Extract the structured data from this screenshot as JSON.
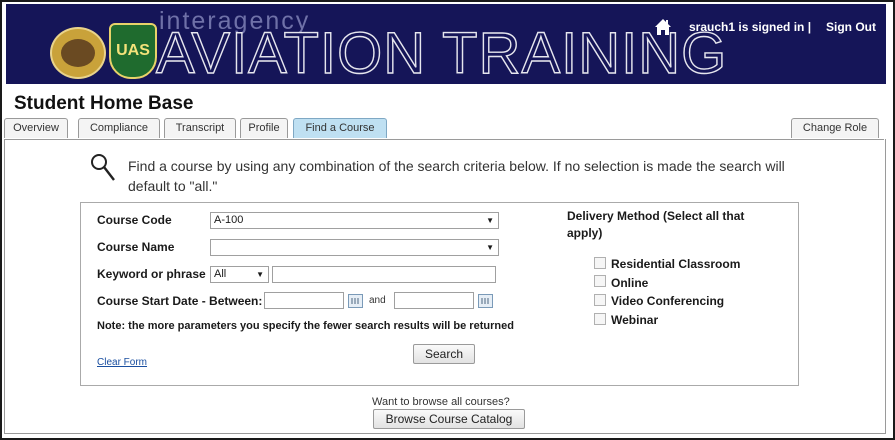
{
  "header": {
    "brand_small": "interagency",
    "brand_big": "AVIATION TRAINING",
    "shield_text": "UAS",
    "signed_in_text": "srauch1 is signed in  |",
    "sign_out": "Sign Out"
  },
  "page_title": "Student Home Base",
  "tabs": [
    {
      "label": "Overview"
    },
    {
      "label": "Compliance"
    },
    {
      "label": "Transcript"
    },
    {
      "label": "Profile"
    },
    {
      "label": "Find a Course",
      "active": true
    }
  ],
  "change_role": "Change Role",
  "intro_text": "Find a course by using any combination of the search criteria below. If no selection is made the search will default to \"all.\"",
  "form": {
    "course_code_label": "Course Code",
    "course_code_value": "A-100",
    "course_name_label": "Course Name",
    "course_name_value": "",
    "keyword_label": "Keyword or phrase",
    "keyword_mode": "All",
    "keyword_value": "",
    "start_date_label": "Course Start Date - Between:",
    "date_from": "",
    "and_text": "and",
    "date_to": "",
    "note": "Note: the more parameters you specify the fewer search results will be returned",
    "search_button": "Search",
    "clear_form": "Clear Form"
  },
  "delivery": {
    "label": "Delivery Method (Select all that apply)",
    "options": [
      {
        "label": "Residential Classroom",
        "checked": false
      },
      {
        "label": "Online",
        "checked": false
      },
      {
        "label": "Video Conferencing",
        "checked": false
      },
      {
        "label": "Webinar",
        "checked": false
      }
    ]
  },
  "browse": {
    "question": "Want to browse all courses?",
    "button": "Browse Course Catalog"
  }
}
